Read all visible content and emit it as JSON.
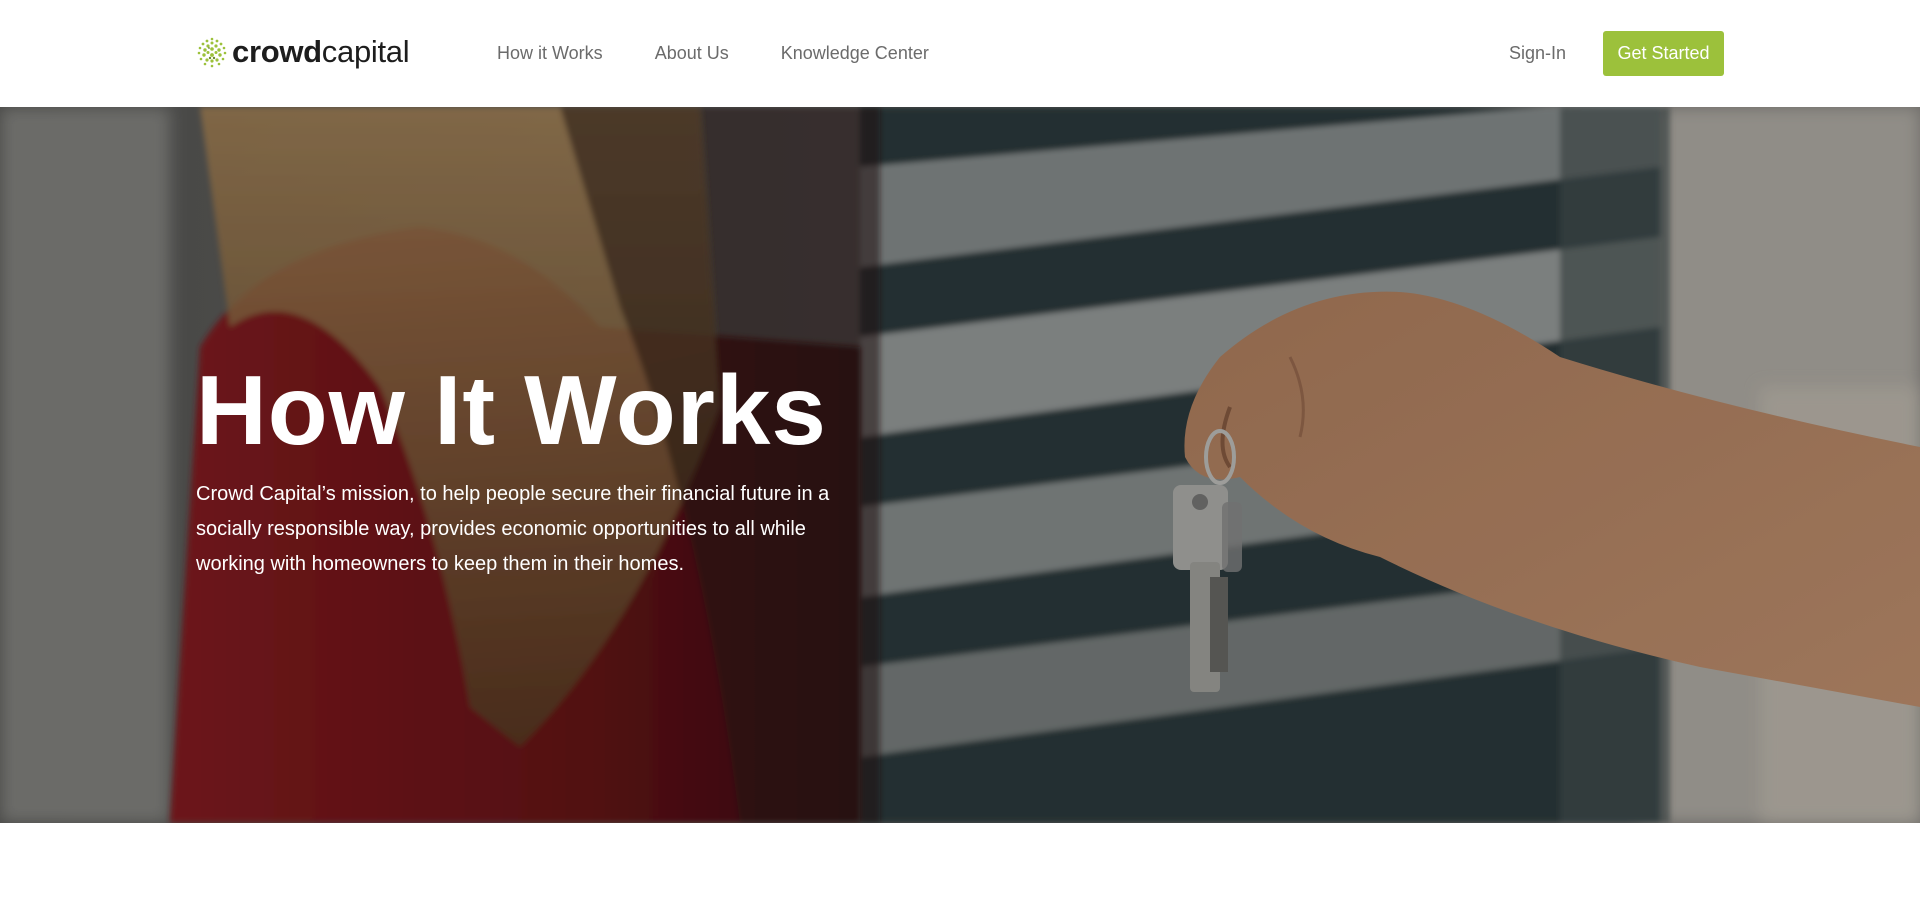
{
  "header": {
    "logo": {
      "bold": "crowd",
      "light": "capital",
      "icon": "crowd-dots-logo-icon"
    },
    "nav": [
      {
        "label": "How it Works"
      },
      {
        "label": "About Us"
      },
      {
        "label": "Knowledge Center"
      }
    ],
    "signin_label": "Sign-In",
    "cta_label": "Get Started"
  },
  "hero": {
    "title": "How It Works",
    "description": "Crowd Capital’s mission, to help people secure their financial future in a socially responsible way, provides economic opportunities to all while working with homeowners to keep them in their homes.",
    "image": "photo-hand-holding-house-keys"
  },
  "colors": {
    "accent": "#9cc13b",
    "nav_text": "#6b6b6b",
    "logo_text": "#1d1d1d",
    "hero_text": "#ffffff"
  }
}
